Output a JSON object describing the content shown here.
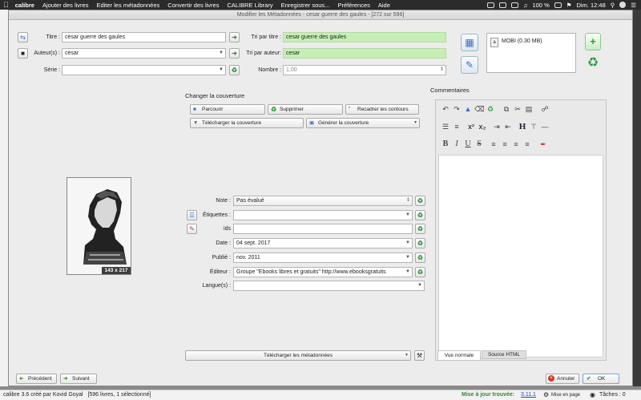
{
  "menubar": {
    "app_name": "calibre",
    "items": [
      "Ajouter des livres",
      "Editer les métadonnées",
      "Convertir des livres",
      "CALIBRE Library",
      "Enregistrer sous...",
      "Préférences",
      "Aide"
    ],
    "battery": "100 %",
    "clock": "Dim. 12:48"
  },
  "dialog": {
    "title": "Modifier les Métadonnées - cesar guerre des gaules - [272 sur 596]"
  },
  "form": {
    "title_label": "Titre :",
    "title_value": "cesar guerre des gaules",
    "title_sort_label": "Tri par titre :",
    "title_sort_value": "cesar guerre des gaules",
    "authors_label": "Auteur(s) :",
    "authors_value": "cesar",
    "author_sort_label": "Tri par auteur:",
    "author_sort_value": "cesar",
    "series_label": "Série :",
    "series_value": "",
    "number_label": "Nombre :",
    "number_value": "1,00"
  },
  "formats": {
    "item": "MOBI (0.30 MB)"
  },
  "cover": {
    "section_label": "Changer la couverture",
    "browse": "Parcourir",
    "remove": "Supprimer",
    "trim": "Recadrer les contours",
    "download": "Télécharger la couverture",
    "generate": "Générer la couverture",
    "size_badge": "143 x 217"
  },
  "meta": {
    "rating_label": "Note :",
    "rating_value": "Pas évalué",
    "tags_label": "Étiquettes :",
    "tags_value": "",
    "ids_label": "ids",
    "ids_value": "",
    "date_label": "Date :",
    "date_value": "04 sept. 2017",
    "published_label": "Publié :",
    "published_value": "nov. 2011",
    "publisher_label": "Éditeur :",
    "publisher_value": "Groupe \"Ebooks libres et gratuits\" http://www.ebooksgratuits",
    "languages_label": "Langue(s) :",
    "languages_value": ""
  },
  "download_metadata": "Télécharger les métadonnées",
  "comments": {
    "label": "Commentaires",
    "tab_normal": "Vue normale",
    "tab_html": "Source HTML"
  },
  "buttons": {
    "previous": "Précédent",
    "next": "Suivant",
    "cancel": "Annuler",
    "ok": "OK"
  },
  "status": {
    "left": "calibre 3.6 créé par Kovid Goyal   [596 livres, 1 sélectionné]",
    "update_prefix": "Mise à jour trouvée:",
    "update_version": "3.11.1",
    "layout": "Mise en page",
    "jobs": "Tâches : 0"
  },
  "colors": {
    "accent_green": "#c6efb4",
    "ok_green": "#2f9a3a",
    "cancel_red": "#d23a2a"
  }
}
